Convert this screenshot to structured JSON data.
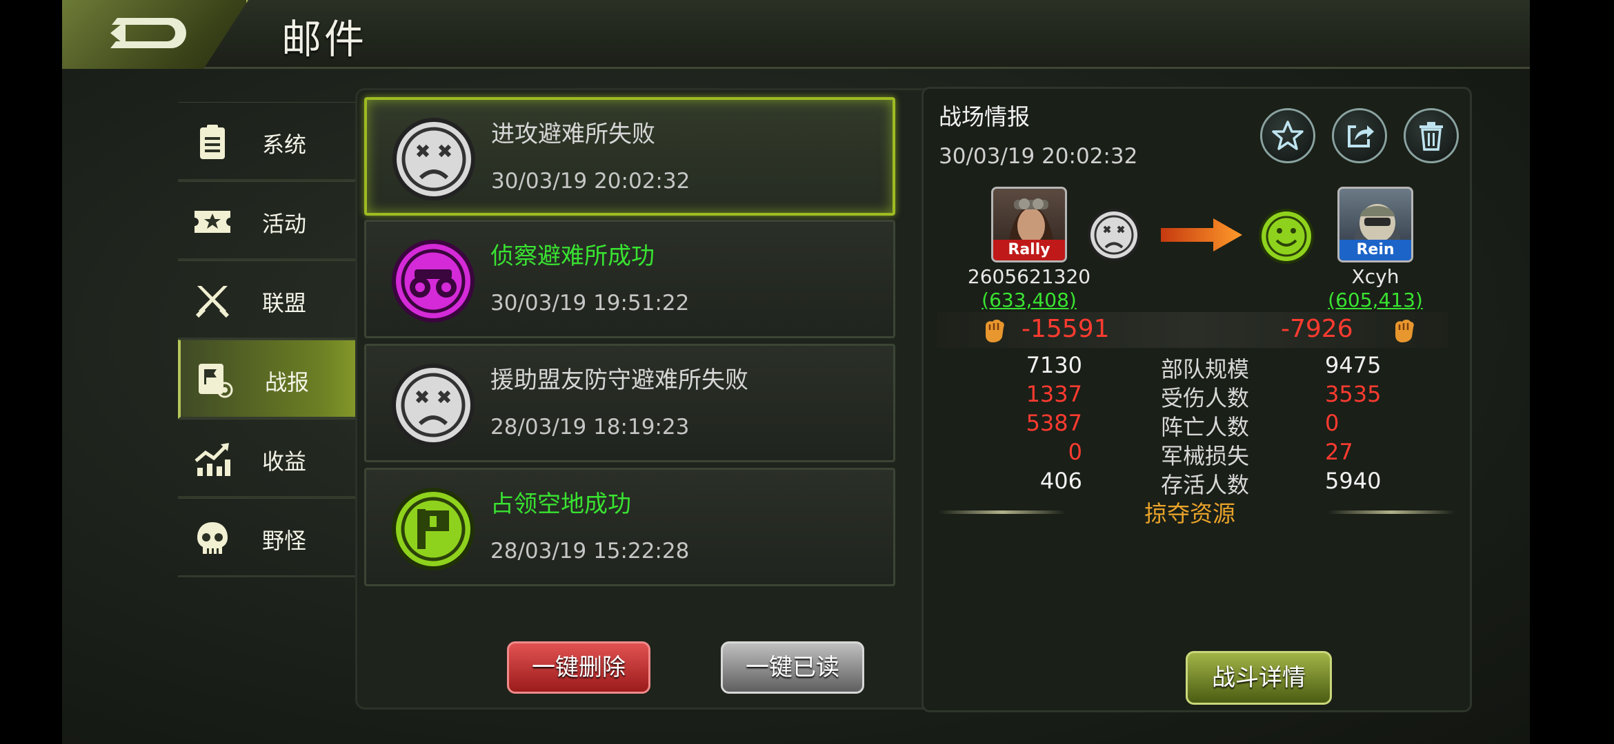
{
  "header": {
    "title": "邮件",
    "back_icon": "back-arrow-icon"
  },
  "sidebar": {
    "items": [
      {
        "label": "系统",
        "icon": "clipboard-icon",
        "active": false
      },
      {
        "label": "活动",
        "icon": "ticket-star-icon",
        "active": false
      },
      {
        "label": "联盟",
        "icon": "crossed-swords-icon",
        "active": false
      },
      {
        "label": "战报",
        "icon": "report-flag-icon",
        "active": true
      },
      {
        "label": "收益",
        "icon": "growth-chart-icon",
        "active": false
      },
      {
        "label": "野怪",
        "icon": "skull-icon",
        "active": false
      }
    ]
  },
  "mail_list": {
    "items": [
      {
        "title": "进攻避难所失败",
        "time": "30/03/19  20:02:32",
        "icon": "sad-face-icon",
        "result": "fail",
        "selected": true
      },
      {
        "title": "侦察避难所成功",
        "time": "30/03/19  19:51:22",
        "icon": "binoculars-icon",
        "result": "success",
        "selected": false
      },
      {
        "title": "援助盟友防守避难所失败",
        "time": "28/03/19  18:19:23",
        "icon": "sad-face-icon",
        "result": "fail",
        "selected": false
      },
      {
        "title": "占领空地成功",
        "time": "28/03/19  15:22:28",
        "icon": "flag-icon",
        "result": "success",
        "selected": false
      }
    ],
    "delete_all_label": "一键删除",
    "read_all_label": "一键已读"
  },
  "report": {
    "title": "战场情报",
    "time": "30/03/19  20:02:32",
    "actions": [
      "star-icon",
      "share-icon",
      "trash-icon"
    ],
    "attacker": {
      "tag": "Rally",
      "name": "2605621320",
      "power": "(633,408)",
      "loss": "-15591"
    },
    "defender": {
      "tag": "Rein",
      "name": "Xcyh",
      "power": "(605,413)",
      "loss": "-7926"
    },
    "stats": [
      {
        "label": "部队规模",
        "a": "7130",
        "b": "9475",
        "a_color": "white",
        "b_color": "white"
      },
      {
        "label": "受伤人数",
        "a": "1337",
        "b": "3535",
        "a_color": "red",
        "b_color": "red"
      },
      {
        "label": "阵亡人数",
        "a": "5387",
        "b": "0",
        "a_color": "red",
        "b_color": "red"
      },
      {
        "label": "军械损失",
        "a": "0",
        "b": "27",
        "a_color": "red",
        "b_color": "red"
      },
      {
        "label": "存活人数",
        "a": "406",
        "b": "5940",
        "a_color": "white",
        "b_color": "white"
      }
    ],
    "loot_title": "掠夺资源",
    "details_label": "战斗详情"
  },
  "colors": {
    "success_green": "#39e331",
    "loss_red": "#ff3b30",
    "loot_orange": "#e8a32a",
    "accent_olive": "#a7bd32"
  }
}
